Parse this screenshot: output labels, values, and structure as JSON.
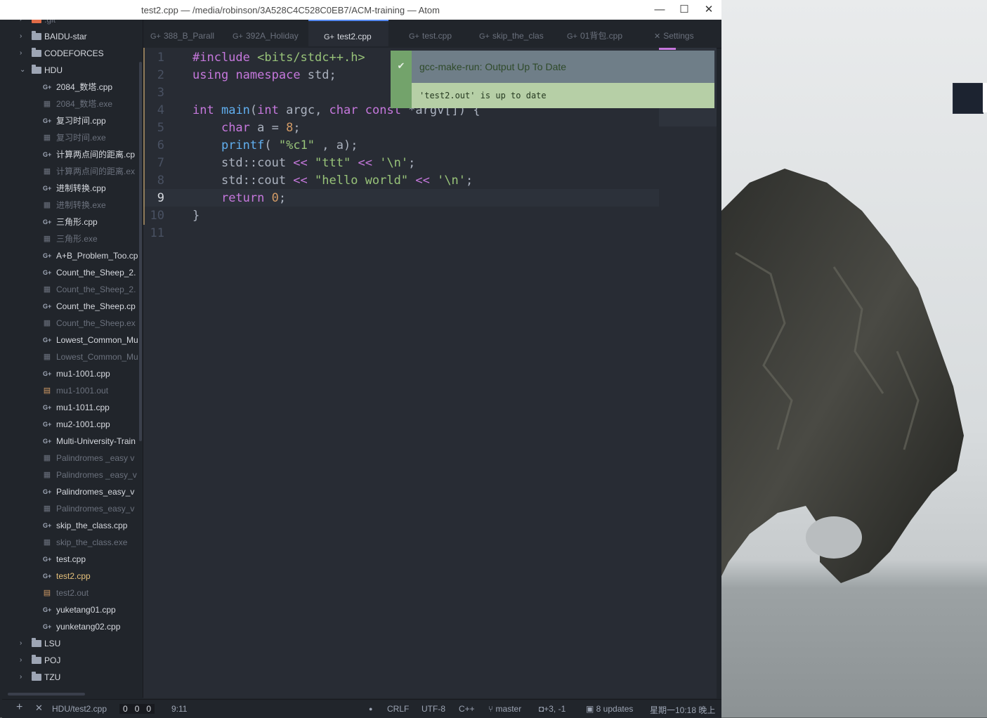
{
  "window": {
    "title": "test2.cpp — /media/robinson/3A528C4C528C0EB7/ACM-training — Atom",
    "minimize": "—",
    "maximize": "☐",
    "close": "✕"
  },
  "sidebar": {
    "items": [
      {
        "label": ".git",
        "type": "folder-git",
        "partial": true
      },
      {
        "label": "BAIDU-star",
        "type": "folder"
      },
      {
        "label": "CODEFORCES",
        "type": "folder"
      },
      {
        "label": "HDU",
        "type": "folder-open"
      },
      {
        "label": "2084_数塔.cpp",
        "type": "cpp"
      },
      {
        "label": "2084_数塔.exe",
        "type": "exe"
      },
      {
        "label": "复习时间.cpp",
        "type": "cpp"
      },
      {
        "label": "复习时间.exe",
        "type": "exe"
      },
      {
        "label": "计算两点间的距离.cp",
        "type": "cpp"
      },
      {
        "label": "计算两点间的距离.ex",
        "type": "exe"
      },
      {
        "label": "进制转换.cpp",
        "type": "cpp"
      },
      {
        "label": "进制转换.exe",
        "type": "exe"
      },
      {
        "label": "三角形.cpp",
        "type": "cpp"
      },
      {
        "label": "三角形.exe",
        "type": "exe"
      },
      {
        "label": "A+B_Problem_Too.cp",
        "type": "cpp"
      },
      {
        "label": "Count_the_Sheep_2.",
        "type": "cpp"
      },
      {
        "label": "Count_the_Sheep_2.",
        "type": "exe"
      },
      {
        "label": "Count_the_Sheep.cp",
        "type": "cpp"
      },
      {
        "label": "Count_the_Sheep.ex",
        "type": "exe"
      },
      {
        "label": "Lowest_Common_Mu",
        "type": "cpp"
      },
      {
        "label": "Lowest_Common_Mu",
        "type": "exe"
      },
      {
        "label": "mu1-1001.cpp",
        "type": "cpp"
      },
      {
        "label": "mu1-1001.out",
        "type": "out"
      },
      {
        "label": "mu1-1011.cpp",
        "type": "cpp"
      },
      {
        "label": "mu2-1001.cpp",
        "type": "cpp"
      },
      {
        "label": "Multi-University-Train",
        "type": "cpp"
      },
      {
        "label": "Palindromes _easy v",
        "type": "exe"
      },
      {
        "label": "Palindromes _easy_v",
        "type": "exe"
      },
      {
        "label": "Palindromes_easy_v",
        "type": "cpp"
      },
      {
        "label": "Palindromes_easy_v",
        "type": "exe"
      },
      {
        "label": "skip_the_class.cpp",
        "type": "cpp"
      },
      {
        "label": "skip_the_class.exe",
        "type": "exe"
      },
      {
        "label": "test.cpp",
        "type": "cpp"
      },
      {
        "label": "test2.cpp",
        "type": "cpp-active"
      },
      {
        "label": "test2.out",
        "type": "out"
      },
      {
        "label": "yuketang01.cpp",
        "type": "cpp"
      },
      {
        "label": "yunketang02.cpp",
        "type": "cpp"
      },
      {
        "label": "LSU",
        "type": "folder"
      },
      {
        "label": "POJ",
        "type": "folder"
      },
      {
        "label": "TZU",
        "type": "folder"
      }
    ]
  },
  "tabs": [
    {
      "label": "388_B_Parall",
      "active": false
    },
    {
      "label": "392A_Holiday",
      "active": false
    },
    {
      "label": "test2.cpp",
      "active": true
    },
    {
      "label": "test.cpp",
      "active": false
    },
    {
      "label": "skip_the_clas",
      "active": false
    },
    {
      "label": "01背包.cpp",
      "active": false
    },
    {
      "label": "Settings",
      "active": false
    }
  ],
  "editor": {
    "line_numbers": [
      "1",
      "2",
      "3",
      "4",
      "5",
      "6",
      "7",
      "8",
      "9",
      "10",
      "11"
    ],
    "current_line": "9"
  },
  "notification": {
    "title": "gcc-make-run: Output Up To Date",
    "message": "'test2.out' is up to date"
  },
  "status": {
    "add": "+",
    "close": "✕",
    "file_path": "HDU/test2.cpp",
    "lint_counts": [
      "0",
      "0",
      "0"
    ],
    "cursor": "9:11",
    "dot": "●",
    "line_ending": "CRLF",
    "encoding": "UTF-8",
    "grammar": "C++",
    "branch": "master",
    "diff": "+3, -1",
    "updates": "8 updates",
    "clock": "星期一10:18 晚上"
  },
  "colors": {
    "accent": "#568af2",
    "success": "#73a36b",
    "keyword": "#c678dd",
    "string": "#98c379",
    "number": "#d19a66"
  }
}
